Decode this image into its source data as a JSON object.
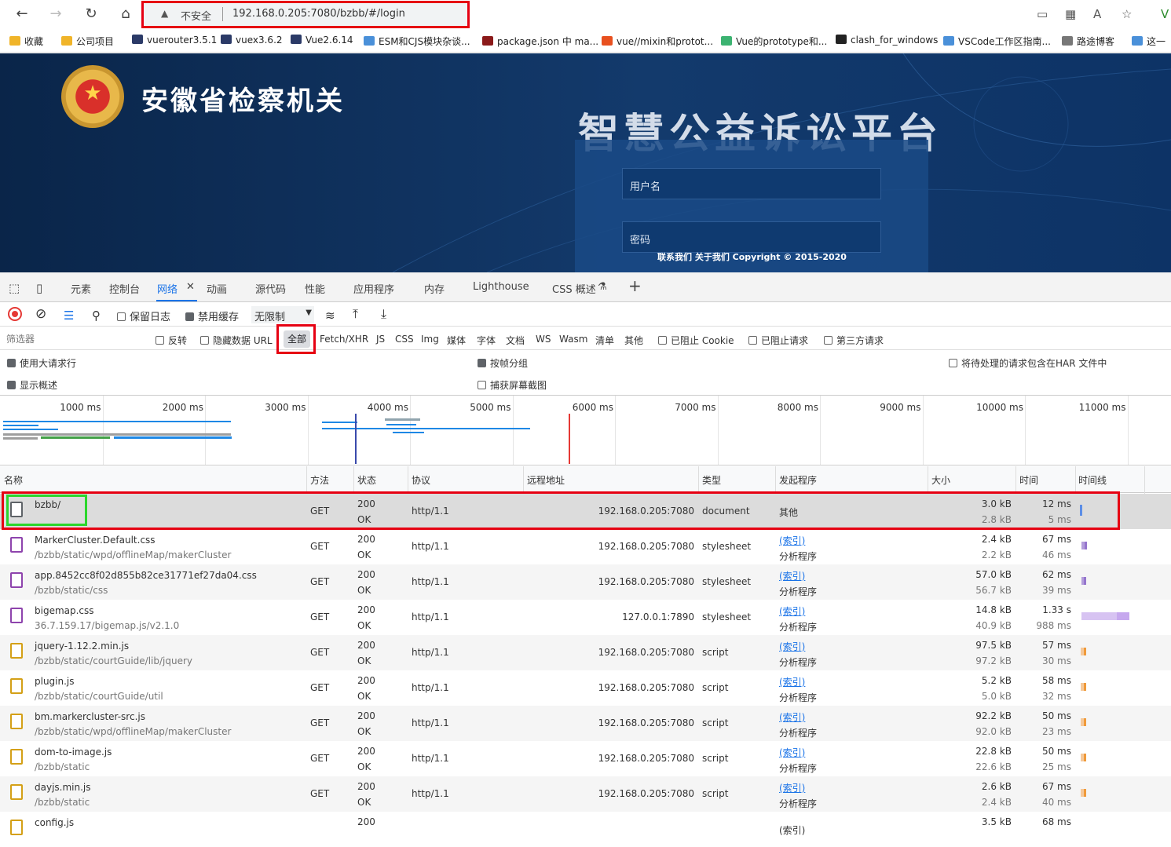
{
  "browser": {
    "nav": {
      "back": "←",
      "forward": "→",
      "reload": "↻",
      "home": "⌂"
    },
    "security_warning": "不安全",
    "url": "192.168.0.205:7080/bzbb/#/login",
    "bookmarks": [
      "收藏",
      "公司项目",
      "vuerouter3.5.1",
      "vuex3.6.2",
      "Vue2.6.14",
      "ESM和CJS模块杂谈...",
      "package.json 中 ma...",
      "vue//mixin和protot...",
      "Vue的prototype和...",
      "clash_for_windows",
      "VSCode工作区指南...",
      "路途博客",
      "这一"
    ],
    "bookmark_colors": [
      "#f0b429",
      "#f0b429",
      "#2b3a67",
      "#2b3a67",
      "#2b3a67",
      "#4a90d9",
      "#8b1a1a",
      "#e8501f",
      "#3cb371",
      "#222222",
      "#4a90d9",
      "#777777",
      "#4a90d9"
    ]
  },
  "site": {
    "org_name": "安徽省检察机关",
    "platform_title": "智慧公益诉讼平台",
    "username_placeholder": "用户名",
    "password_placeholder": "密码",
    "footer": "联系我们 关于我们 Copyright © 2015-2020"
  },
  "devtools": {
    "tabs": [
      "元素",
      "控制台",
      "网络",
      "动画",
      "源代码",
      "性能",
      "应用程序",
      "内存",
      "Lighthouse",
      "CSS 概述"
    ],
    "active_tab": "网络",
    "toolbar": {
      "preserve_log": "保留日志",
      "disable_cache": "禁用缓存",
      "throttling": "无限制"
    },
    "filter": {
      "placeholder": "筛选器",
      "invert": "反转",
      "hide_data_urls": "隐藏数据 URL",
      "types": [
        "全部",
        "Fetch/XHR",
        "JS",
        "CSS",
        "Img",
        "媒体",
        "字体",
        "文档",
        "WS",
        "Wasm",
        "清单",
        "其他"
      ],
      "blocked_cookies": "已阻止 Cookie",
      "blocked_requests": "已阻止请求",
      "third_party": "第三方请求"
    },
    "options": {
      "big_rows": "使用大请求行",
      "group_by_frame": "按帧分组",
      "har": "将待处理的请求包含在HAR 文件中",
      "show_overview": "显示概述",
      "screenshots": "捕获屏幕截图"
    },
    "timeline_ticks": [
      "1000 ms",
      "2000 ms",
      "3000 ms",
      "4000 ms",
      "5000 ms",
      "6000 ms",
      "7000 ms",
      "8000 ms",
      "9000 ms",
      "10000 ms",
      "11000 ms"
    ],
    "columns": [
      "名称",
      "方法",
      "状态",
      "协议",
      "远程地址",
      "类型",
      "发起程序",
      "大小",
      "时间",
      "时间线"
    ],
    "requests": [
      {
        "name": "bzbb/",
        "path": "",
        "method": "GET",
        "status": "200",
        "status_text": "OK",
        "protocol": "http/1.1",
        "remote": "192.168.0.205:7080",
        "type": "document",
        "initiator": "其他",
        "initiator_sub": "",
        "size": "3.0 kB",
        "size2": "2.8 kB",
        "time": "12 ms",
        "time2": "5 ms",
        "icon_color": "#5f6368"
      },
      {
        "name": "MarkerCluster.Default.css",
        "path": "/bzbb/static/wpd/offlineMap/makerCluster",
        "method": "GET",
        "status": "200",
        "status_text": "OK",
        "protocol": "http/1.1",
        "remote": "192.168.0.205:7080",
        "type": "stylesheet",
        "initiator": "(索引)",
        "initiator_sub": "分析程序",
        "size": "2.4 kB",
        "size2": "2.2 kB",
        "time": "67 ms",
        "time2": "46 ms",
        "icon_color": "#8e44ad"
      },
      {
        "name": "app.8452cc8f02d855b82ce31771ef27da04.css",
        "path": "/bzbb/static/css",
        "method": "GET",
        "status": "200",
        "status_text": "OK",
        "protocol": "http/1.1",
        "remote": "192.168.0.205:7080",
        "type": "stylesheet",
        "initiator": "(索引)",
        "initiator_sub": "分析程序",
        "size": "57.0 kB",
        "size2": "56.7 kB",
        "time": "62 ms",
        "time2": "39 ms",
        "icon_color": "#8e44ad"
      },
      {
        "name": "bigemap.css",
        "path": "36.7.159.17/bigemap.js/v2.1.0",
        "method": "GET",
        "status": "200",
        "status_text": "OK",
        "protocol": "http/1.1",
        "remote": "127.0.0.1:7890",
        "type": "stylesheet",
        "initiator": "(索引)",
        "initiator_sub": "分析程序",
        "size": "14.8 kB",
        "size2": "40.9 kB",
        "time": "1.33 s",
        "time2": "988 ms",
        "icon_color": "#8e44ad"
      },
      {
        "name": "jquery-1.12.2.min.js",
        "path": "/bzbb/static/courtGuide/lib/jquery",
        "method": "GET",
        "status": "200",
        "status_text": "OK",
        "protocol": "http/1.1",
        "remote": "192.168.0.205:7080",
        "type": "script",
        "initiator": "(索引)",
        "initiator_sub": "分析程序",
        "size": "97.5 kB",
        "size2": "97.2 kB",
        "time": "57 ms",
        "time2": "30 ms",
        "icon_color": "#d4a017"
      },
      {
        "name": "plugin.js",
        "path": "/bzbb/static/courtGuide/util",
        "method": "GET",
        "status": "200",
        "status_text": "OK",
        "protocol": "http/1.1",
        "remote": "192.168.0.205:7080",
        "type": "script",
        "initiator": "(索引)",
        "initiator_sub": "分析程序",
        "size": "5.2 kB",
        "size2": "5.0 kB",
        "time": "58 ms",
        "time2": "32 ms",
        "icon_color": "#d4a017"
      },
      {
        "name": "bm.markercluster-src.js",
        "path": "/bzbb/static/wpd/offlineMap/makerCluster",
        "method": "GET",
        "status": "200",
        "status_text": "OK",
        "protocol": "http/1.1",
        "remote": "192.168.0.205:7080",
        "type": "script",
        "initiator": "(索引)",
        "initiator_sub": "分析程序",
        "size": "92.2 kB",
        "size2": "92.0 kB",
        "time": "50 ms",
        "time2": "23 ms",
        "icon_color": "#d4a017"
      },
      {
        "name": "dom-to-image.js",
        "path": "/bzbb/static",
        "method": "GET",
        "status": "200",
        "status_text": "OK",
        "protocol": "http/1.1",
        "remote": "192.168.0.205:7080",
        "type": "script",
        "initiator": "(索引)",
        "initiator_sub": "分析程序",
        "size": "22.8 kB",
        "size2": "22.6 kB",
        "time": "50 ms",
        "time2": "25 ms",
        "icon_color": "#d4a017"
      },
      {
        "name": "dayjs.min.js",
        "path": "/bzbb/static",
        "method": "GET",
        "status": "200",
        "status_text": "OK",
        "protocol": "http/1.1",
        "remote": "192.168.0.205:7080",
        "type": "script",
        "initiator": "(索引)",
        "initiator_sub": "分析程序",
        "size": "2.6 kB",
        "size2": "2.4 kB",
        "time": "67 ms",
        "time2": "40 ms",
        "icon_color": "#d4a017"
      },
      {
        "name": "config.js",
        "path": "",
        "method": "",
        "status": "200",
        "status_text": "",
        "protocol": "",
        "remote": "",
        "type": "",
        "initiator": "(索引)",
        "initiator_sub": "",
        "size": "3.5 kB",
        "size2": "",
        "time": "68 ms",
        "time2": "",
        "icon_color": "#d4a017"
      }
    ]
  }
}
